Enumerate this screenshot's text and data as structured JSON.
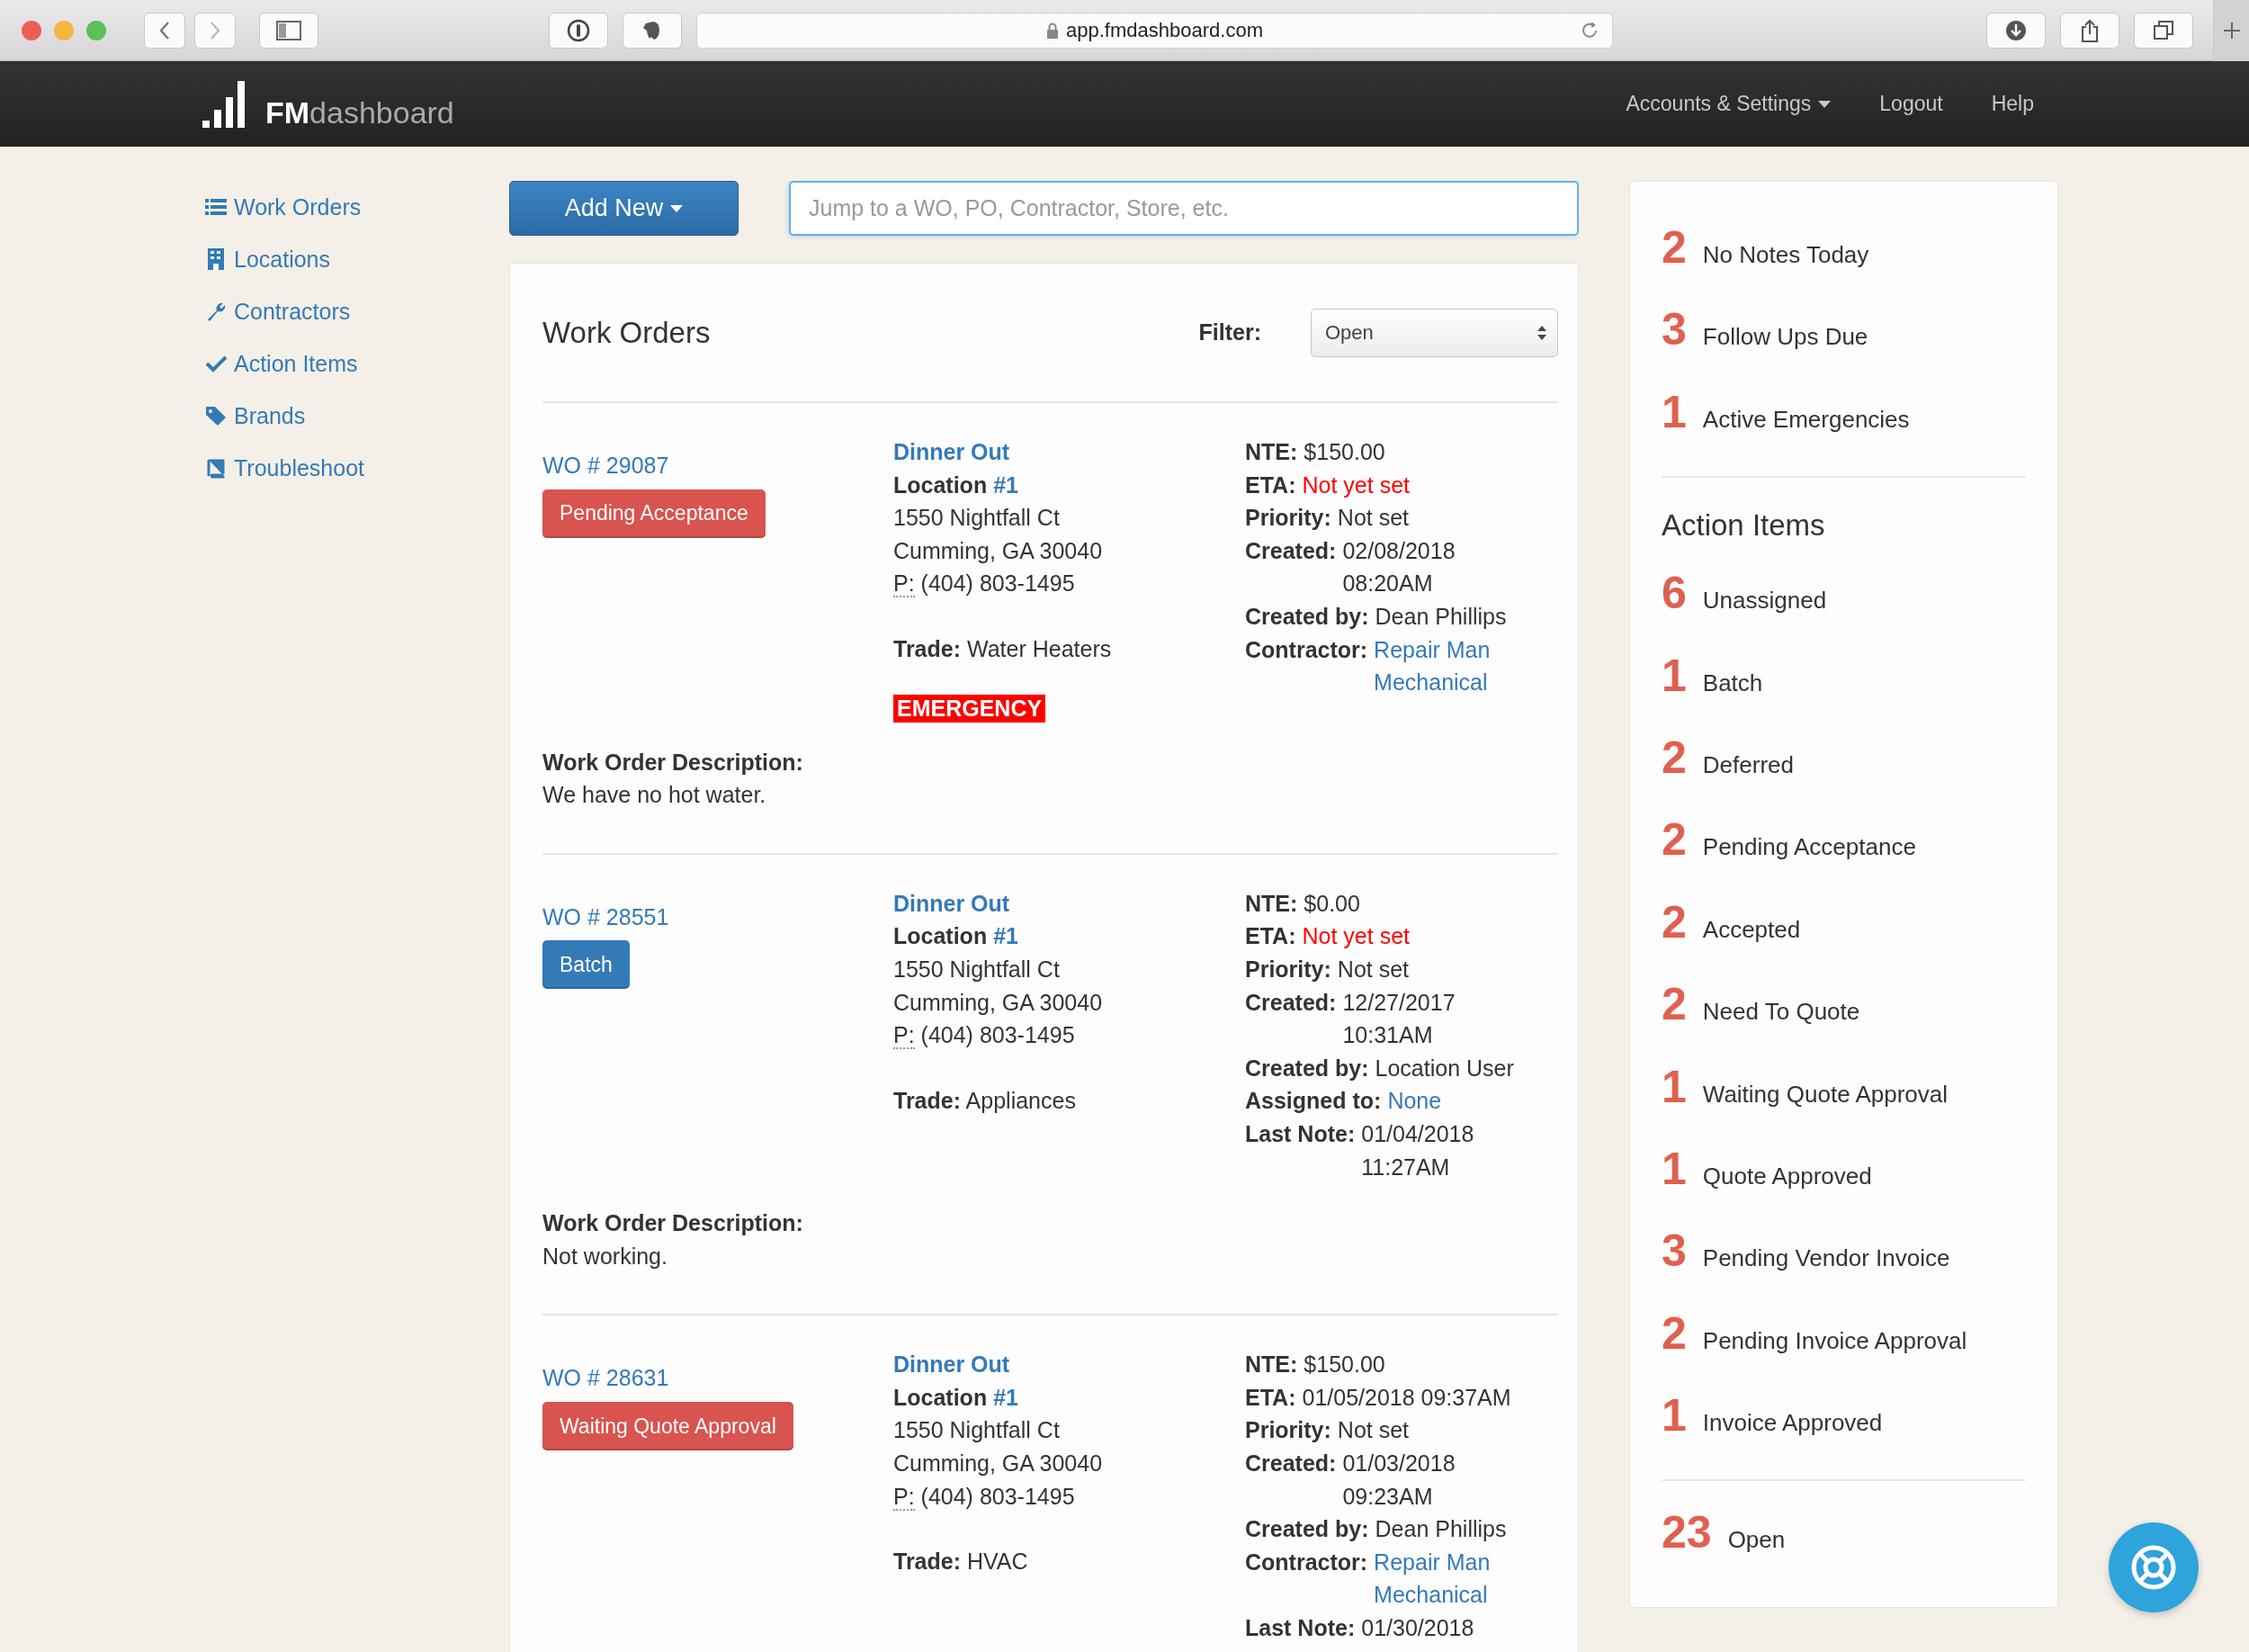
{
  "browser": {
    "url": "app.fmdashboard.com"
  },
  "navbar": {
    "logo_bold": "FM",
    "logo_rest": "dashboard",
    "links": [
      {
        "label": "Accounts & Settings",
        "dropdown": true
      },
      {
        "label": "Logout",
        "dropdown": false
      },
      {
        "label": "Help",
        "dropdown": false
      }
    ]
  },
  "sidebar": {
    "items": [
      {
        "label": "Work Orders"
      },
      {
        "label": "Locations"
      },
      {
        "label": "Contractors"
      },
      {
        "label": "Action Items"
      },
      {
        "label": "Brands"
      },
      {
        "label": "Troubleshoot"
      }
    ]
  },
  "toolbar": {
    "add_button": "Add New",
    "search": {
      "placeholder": "Jump to a WO, PO, Contractor, Store, etc."
    }
  },
  "work_orders": {
    "title": "Work Orders",
    "filter": {
      "label": "Filter:",
      "value": "Open"
    },
    "orders": [
      {
        "number": "WO # 29087",
        "status": {
          "label": "Pending Acceptance",
          "color": "#d9534f"
        },
        "store": "Dinner Out",
        "location_label": "Location",
        "location_number": "#1",
        "address": [
          "1550 Nightfall Ct",
          "Cumming, GA 30040"
        ],
        "phone_label": "P:",
        "phone": "(404) 803-1495",
        "trade_label": "Trade:",
        "trade": "Water Heaters",
        "emergency": "EMERGENCY",
        "details": [
          {
            "label": "NTE:",
            "value": "$150.00",
            "kind": "plain"
          },
          {
            "label": "ETA:",
            "value": "Not yet set",
            "kind": "alert"
          },
          {
            "label": "Priority:",
            "value": "Not set",
            "kind": "plain"
          },
          {
            "label": "Created:",
            "value": "02/08/2018 08:20AM",
            "kind": "plain"
          },
          {
            "label": "Created by:",
            "value": "Dean Phillips",
            "kind": "plain"
          },
          {
            "label": "Contractor:",
            "value": "Repair Man Mechanical",
            "kind": "link"
          }
        ],
        "description_label": "Work Order Description:",
        "description": "We have no hot water."
      },
      {
        "number": "WO # 28551",
        "status": {
          "label": "Batch",
          "color": "#337ab7"
        },
        "store": "Dinner Out",
        "location_label": "Location",
        "location_number": "#1",
        "address": [
          "1550 Nightfall Ct",
          "Cumming, GA 30040"
        ],
        "phone_label": "P:",
        "phone": "(404) 803-1495",
        "trade_label": "Trade:",
        "trade": "Appliances",
        "details": [
          {
            "label": "NTE:",
            "value": "$0.00",
            "kind": "plain"
          },
          {
            "label": "ETA:",
            "value": "Not yet set",
            "kind": "alert"
          },
          {
            "label": "Priority:",
            "value": "Not set",
            "kind": "plain"
          },
          {
            "label": "Created:",
            "value": "12/27/2017 10:31AM",
            "kind": "plain"
          },
          {
            "label": "Created by:",
            "value": "Location User",
            "kind": "plain"
          },
          {
            "label": "Assigned to:",
            "value": "None",
            "kind": "link"
          },
          {
            "label": "Last Note:",
            "value": "01/04/2018 11:27AM",
            "kind": "plain"
          }
        ],
        "description_label": "Work Order Description:",
        "description": "Not working."
      },
      {
        "number": "WO # 28631",
        "status": {
          "label": "Waiting Quote Approval",
          "color": "#d9534f"
        },
        "store": "Dinner Out",
        "location_label": "Location",
        "location_number": "#1",
        "address": [
          "1550 Nightfall Ct",
          "Cumming, GA 30040"
        ],
        "phone_label": "P:",
        "phone": "(404) 803-1495",
        "trade_label": "Trade:",
        "trade": "HVAC",
        "details": [
          {
            "label": "NTE:",
            "value": "$150.00",
            "kind": "plain"
          },
          {
            "label": "ETA:",
            "value": "01/05/2018 09:37AM",
            "kind": "plain"
          },
          {
            "label": "Priority:",
            "value": "Not set",
            "kind": "plain"
          },
          {
            "label": "Created:",
            "value": "01/03/2018 09:23AM",
            "kind": "plain"
          },
          {
            "label": "Created by:",
            "value": "Dean Phillips",
            "kind": "plain"
          },
          {
            "label": "Contractor:",
            "value": "Repair Man Mechanical",
            "kind": "link"
          },
          {
            "label": "Last Note:",
            "value": "01/30/2018",
            "kind": "plain"
          }
        ]
      }
    ]
  },
  "panel": {
    "summary": [
      {
        "count": "2",
        "label": "No Notes Today"
      },
      {
        "count": "3",
        "label": "Follow Ups Due"
      },
      {
        "count": "1",
        "label": "Active Emergencies"
      }
    ],
    "heading": "Action Items",
    "action_items": [
      {
        "count": "6",
        "label": "Unassigned"
      },
      {
        "count": "1",
        "label": "Batch"
      },
      {
        "count": "2",
        "label": "Deferred"
      },
      {
        "count": "2",
        "label": "Pending Acceptance"
      },
      {
        "count": "2",
        "label": "Accepted"
      },
      {
        "count": "2",
        "label": "Need To Quote"
      },
      {
        "count": "1",
        "label": "Waiting Quote Approval"
      },
      {
        "count": "1",
        "label": "Quote Approved"
      },
      {
        "count": "3",
        "label": "Pending Vendor Invoice"
      },
      {
        "count": "2",
        "label": "Pending Invoice Approval"
      },
      {
        "count": "1",
        "label": "Invoice Approved"
      }
    ],
    "total": {
      "count": "23",
      "label": "Open"
    }
  }
}
